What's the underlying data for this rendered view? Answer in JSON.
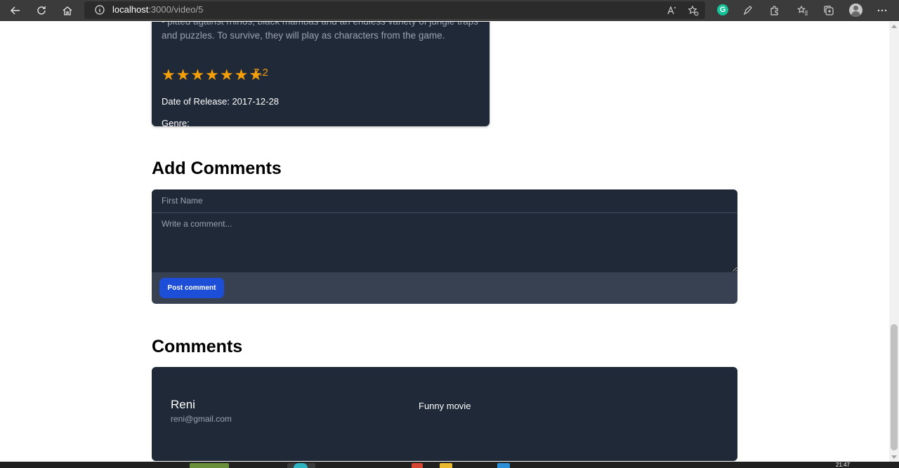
{
  "browser": {
    "url_host": "localhost",
    "url_path": ":3000/video/5"
  },
  "movie": {
    "description": "- pitted against rhinos, black mambas and an endless variety of jungle traps and puzzles. To survive, they will play as characters from the game.",
    "stars": "★★★★★★★",
    "stars_count": 7,
    "rating": "7.2",
    "release_line": "Date of Release: 2017-12-28",
    "genre_label": "Genre:"
  },
  "add_comments": {
    "heading": "Add Comments",
    "first_name_placeholder": "First Name",
    "comment_placeholder": "Write a comment...",
    "post_button": "Post comment"
  },
  "comments": {
    "heading": "Comments",
    "items": [
      {
        "name": "Reni",
        "email": "reni@gmail.com",
        "text": "Funny movie"
      }
    ]
  },
  "taskbar": {
    "clock": "21:47"
  },
  "colors": {
    "card_bg": "#1f2937",
    "form_footer_bg": "#374151",
    "accent_blue": "#1d4ed8",
    "star_color": "#f59e0b"
  }
}
